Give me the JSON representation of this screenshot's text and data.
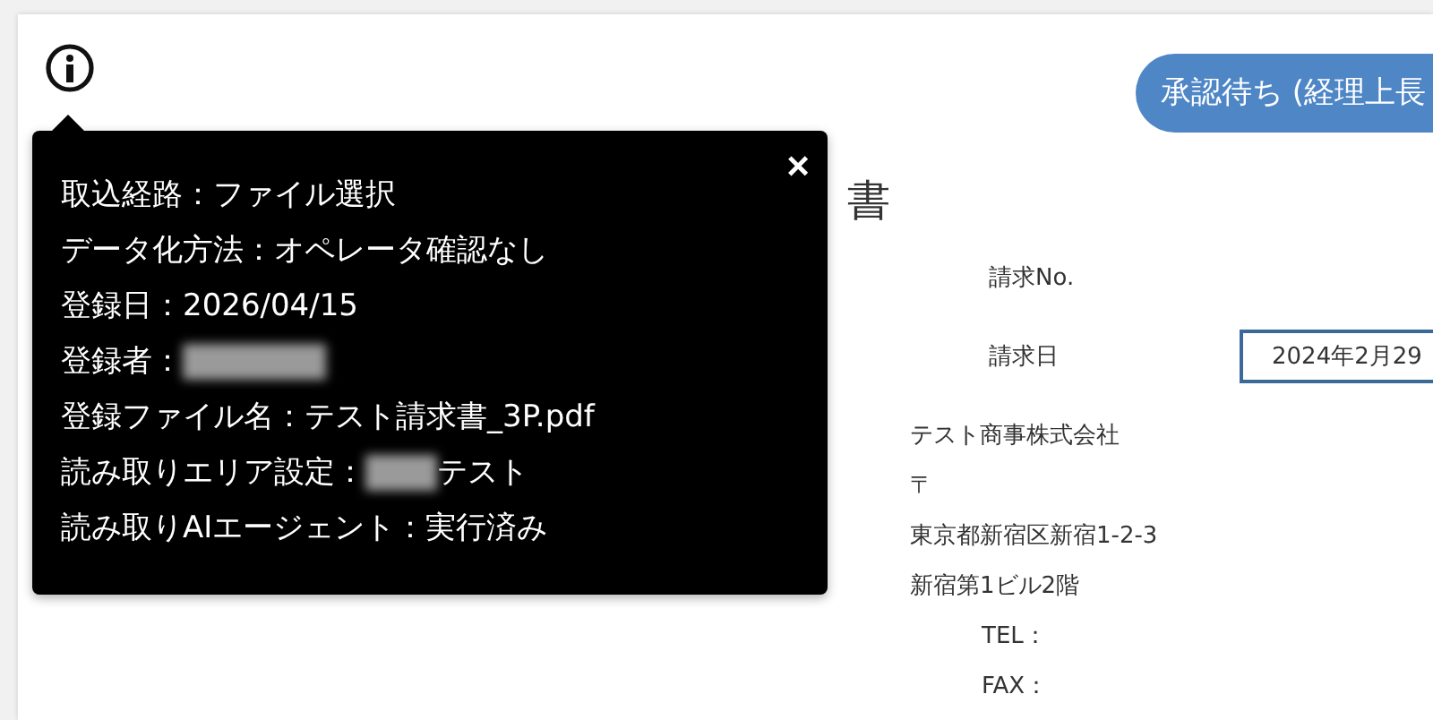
{
  "status_pill": "承認待ち (経理上長",
  "document": {
    "title": "書",
    "fields": [
      {
        "label": "請求No."
      },
      {
        "label": "請求日",
        "value": "2024年2月29"
      }
    ],
    "issuer": [
      "テスト商事株式会社",
      "〒",
      "東京都新宿区新宿1-2-3",
      "新宿第1ビル2階"
    ],
    "contacts": [
      "TEL：",
      "FAX："
    ]
  },
  "info_popup": {
    "close": "×",
    "lines": [
      {
        "text": "取込経路：ファイル選択",
        "redacted": false
      },
      {
        "text": "データ化方法：オペレータ確認なし",
        "redacted": false
      },
      {
        "text": "登録日：2026/04/15",
        "redacted": false
      },
      {
        "text": "登録者：",
        "redacted": true
      },
      {
        "text": "登録ファイル名：テスト請求書_3P.pdf",
        "redacted": false
      },
      {
        "text": "読み取りエリア設定：",
        "redacted": true,
        "after": "テスト"
      },
      {
        "text": "読み取りAIエージェント：実行済み",
        "redacted": false
      }
    ]
  }
}
